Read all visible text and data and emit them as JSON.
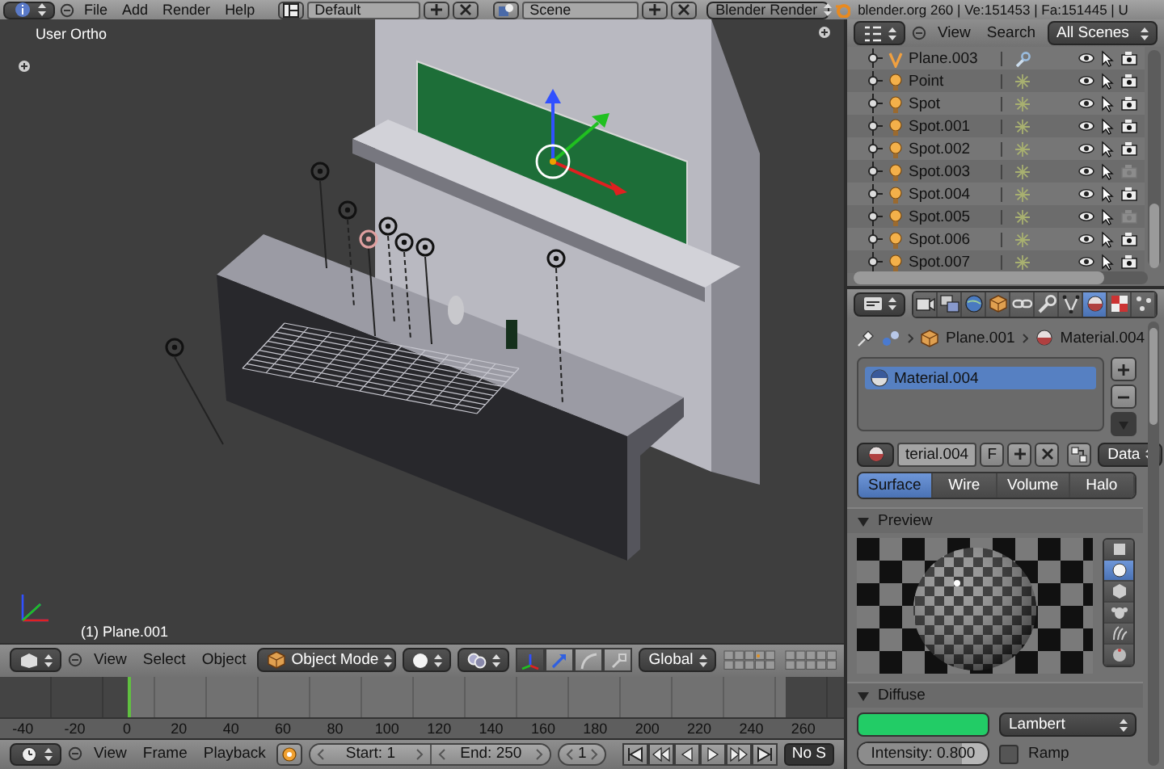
{
  "top_bar": {
    "menus": [
      "File",
      "Add",
      "Render",
      "Help"
    ],
    "screen_layout": "Default",
    "scene": "Scene",
    "render_engine": "Blender Render",
    "stats": "blender.org 260 | Ve:151453 | Fa:151445 | U"
  },
  "viewport": {
    "view_label": "User Ortho",
    "object_label": "(1) Plane.001"
  },
  "viewport_header": {
    "menus": [
      "View",
      "Select",
      "Object"
    ],
    "mode": "Object Mode",
    "orientation": "Global"
  },
  "timeline": {
    "ticks": [
      "-40",
      "-20",
      "0",
      "20",
      "40",
      "60",
      "80",
      "100",
      "120",
      "140",
      "160",
      "180",
      "200",
      "220",
      "240",
      "260"
    ]
  },
  "timeline_header": {
    "menus": [
      "View",
      "Frame",
      "Playback"
    ],
    "start": "Start: 1",
    "end": "End: 250",
    "current_frame": "1",
    "sync": "No S"
  },
  "outliner": {
    "menus": [
      "View",
      "Search"
    ],
    "filter": "All Scenes",
    "items": [
      {
        "name": "Plane.003",
        "kind": "mesh",
        "renderable": true
      },
      {
        "name": "Point",
        "kind": "lamp",
        "renderable": true
      },
      {
        "name": "Spot",
        "kind": "lamp",
        "renderable": true
      },
      {
        "name": "Spot.001",
        "kind": "lamp",
        "renderable": true
      },
      {
        "name": "Spot.002",
        "kind": "lamp",
        "renderable": true
      },
      {
        "name": "Spot.003",
        "kind": "lamp",
        "renderable": false
      },
      {
        "name": "Spot.004",
        "kind": "lamp",
        "renderable": true
      },
      {
        "name": "Spot.005",
        "kind": "lamp",
        "renderable": false
      },
      {
        "name": "Spot.006",
        "kind": "lamp",
        "renderable": true
      },
      {
        "name": "Spot.007",
        "kind": "lamp",
        "renderable": true
      }
    ]
  },
  "properties": {
    "tabs": [
      {
        "kind": "render",
        "selected": false
      },
      {
        "kind": "layers",
        "selected": false
      },
      {
        "kind": "world",
        "selected": false
      },
      {
        "kind": "object",
        "selected": false
      },
      {
        "kind": "constraint",
        "selected": false
      },
      {
        "kind": "modifier",
        "selected": false
      },
      {
        "kind": "data",
        "selected": false
      },
      {
        "kind": "material",
        "selected": true
      },
      {
        "kind": "texture",
        "selected": false
      },
      {
        "kind": "particles",
        "selected": false
      }
    ],
    "breadcrumb": [
      "Plane.001",
      "Material.004"
    ],
    "material_slots": [
      {
        "name": "Material.004",
        "selected": true
      }
    ],
    "material_name": "terial.004",
    "fake_user": "F",
    "link": "Data",
    "types": [
      {
        "label": "Surface",
        "selected": true
      },
      {
        "label": "Wire",
        "selected": false
      },
      {
        "label": "Volume",
        "selected": false
      },
      {
        "label": "Halo",
        "selected": false
      }
    ],
    "panels": [
      {
        "kind": "preview",
        "title": "Preview",
        "expanded": true,
        "shapes": [
          {
            "kind": "plane",
            "selected": false
          },
          {
            "kind": "sphere",
            "selected": true
          },
          {
            "kind": "cube",
            "selected": false
          },
          {
            "kind": "monkey",
            "selected": false
          },
          {
            "kind": "hair",
            "selected": false
          },
          {
            "kind": "world",
            "selected": false
          }
        ]
      },
      {
        "kind": "diffuse",
        "title": "Diffuse",
        "expanded": true,
        "color": "#22cc66",
        "shader": "Lambert",
        "intensity": {
          "label": "Intensity: 0.800",
          "level": 0.8
        },
        "ramp": {
          "label": "Ramp",
          "checked": false
        }
      }
    ]
  }
}
